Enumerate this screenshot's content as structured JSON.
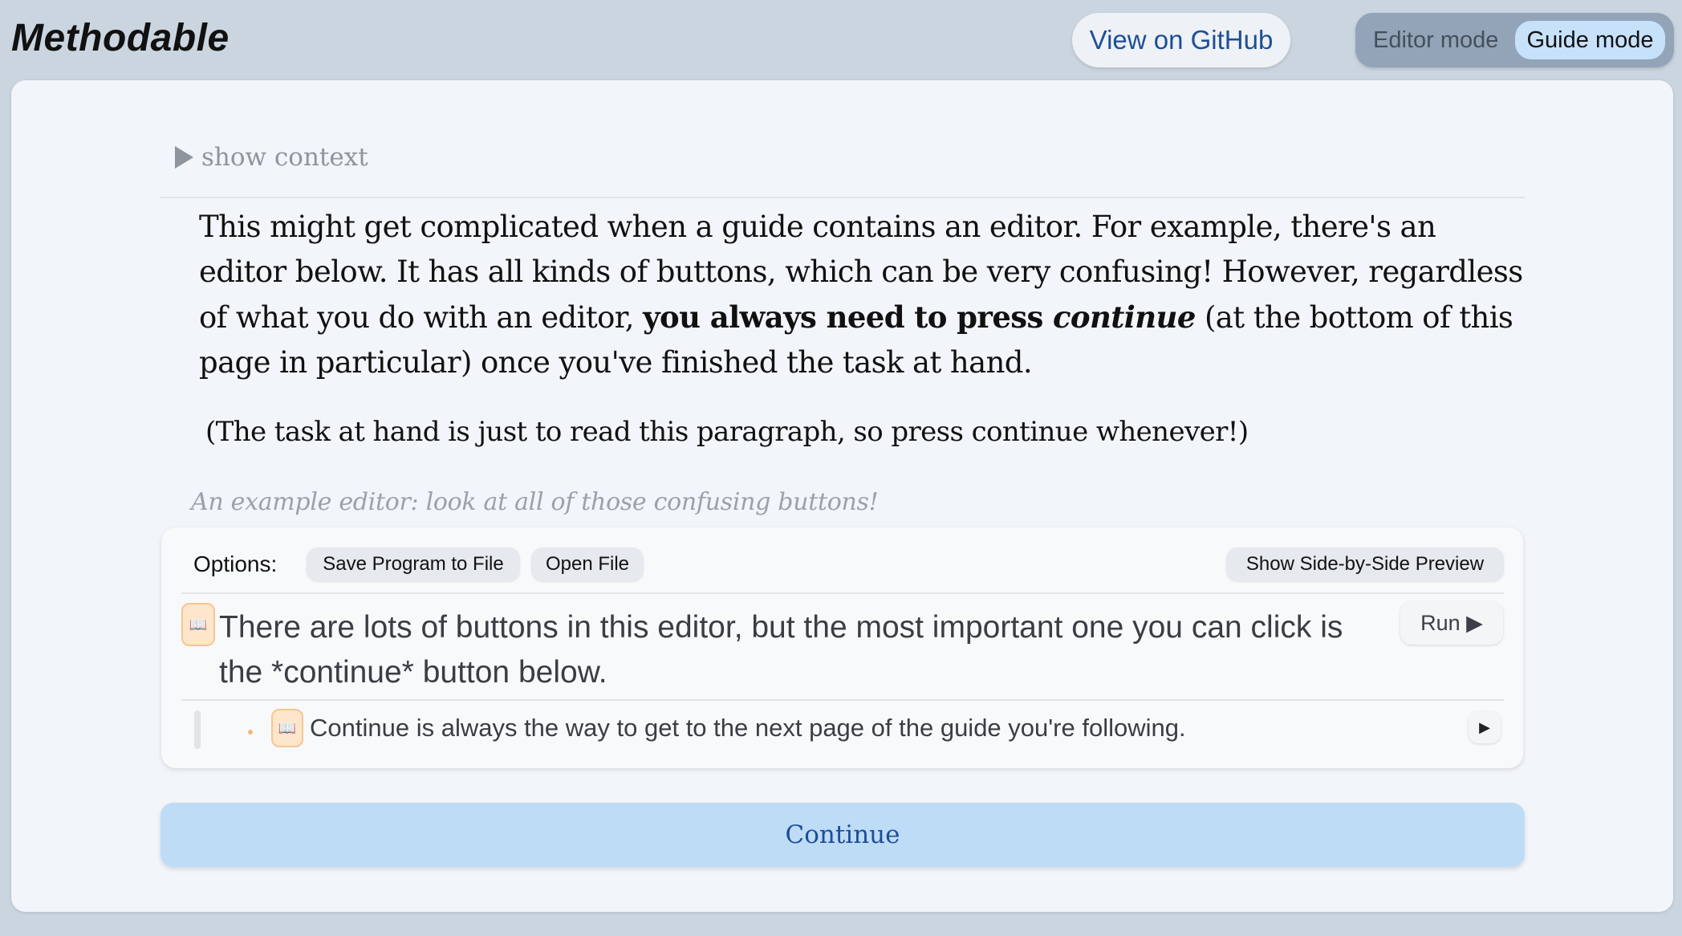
{
  "header": {
    "logo": "Methodable",
    "github_label": "View on GitHub",
    "mode_editor": "Editor mode",
    "mode_guide": "Guide mode",
    "active_mode": "Guide mode"
  },
  "guide": {
    "context_toggle": "show context",
    "paragraph": {
      "part1": "This might get complicated when a guide contains an editor. For example, there's an editor below. It has all kinds of buttons, which can be very confusing! However, regardless of what you do with an editor, ",
      "bold": "you always need to press ",
      "bold_italic": "continue",
      "part2": " (at the bottom of this page in particular) once you've finished the task at hand."
    },
    "note": "(The task at hand is just to read this paragraph, so press continue whenever!)",
    "editor_caption": "An example editor: look at all of those confusing buttons!"
  },
  "editor": {
    "options_label": "Options:",
    "save_label": "Save Program to File",
    "open_label": "Open File",
    "preview_label": "Show Side-by-Side Preview",
    "run_label": "Run ▶",
    "line1": "There are lots of buttons in this editor, but the most important one you can click is the *continue* button below.",
    "line2": "Continue is always the way to get to the next page of the guide you're following.",
    "icon_book": "📖",
    "small_run_label": "▶"
  },
  "continue_label": "Continue",
  "colors": {
    "background": "#cad5e0",
    "card": "#f2f5f9",
    "accent_blue": "#1d4f96",
    "continue_bg": "#bfdcf7",
    "book_icon_bg": "#fde6cc"
  }
}
